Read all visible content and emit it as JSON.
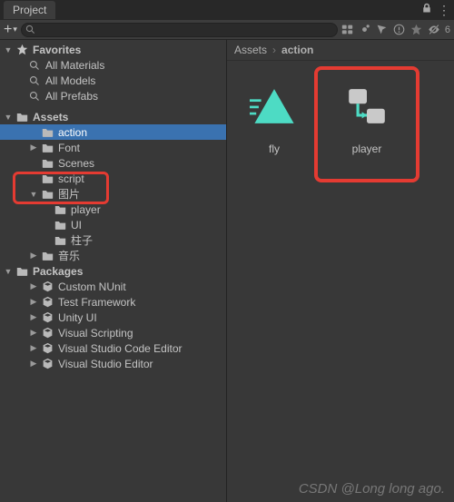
{
  "tab": {
    "title": "Project"
  },
  "toolbar": {
    "search_placeholder": "",
    "hidden_count": "6"
  },
  "breadcrumb": {
    "root": "Assets",
    "current": "action"
  },
  "tree": {
    "favorites_label": "Favorites",
    "favorites": [
      {
        "label": "All Materials"
      },
      {
        "label": "All Models"
      },
      {
        "label": "All Prefabs"
      }
    ],
    "assets_label": "Assets",
    "assets_children": [
      {
        "label": "action",
        "icon": "folder",
        "selected": true,
        "fold": "none",
        "indent": 2
      },
      {
        "label": "Font",
        "icon": "folder",
        "fold": "closed",
        "indent": 2
      },
      {
        "label": "Scenes",
        "icon": "folder",
        "fold": "none",
        "indent": 2
      },
      {
        "label": "script",
        "icon": "folder",
        "fold": "none",
        "indent": 2
      },
      {
        "label": "图片",
        "icon": "folder",
        "fold": "open",
        "indent": 2
      },
      {
        "label": "player",
        "icon": "folder",
        "fold": "none",
        "indent": 3
      },
      {
        "label": "UI",
        "icon": "folder",
        "fold": "none",
        "indent": 3
      },
      {
        "label": "柱子",
        "icon": "folder",
        "fold": "none",
        "indent": 3
      },
      {
        "label": "音乐",
        "icon": "folder",
        "fold": "closed",
        "indent": 2
      }
    ],
    "packages_label": "Packages",
    "packages_children": [
      {
        "label": "Custom NUnit",
        "icon": "package",
        "fold": "closed",
        "indent": 2
      },
      {
        "label": "Test Framework",
        "icon": "package",
        "fold": "closed",
        "indent": 2
      },
      {
        "label": "Unity UI",
        "icon": "package",
        "fold": "closed",
        "indent": 2
      },
      {
        "label": "Visual Scripting",
        "icon": "package",
        "fold": "closed",
        "indent": 2
      },
      {
        "label": "Visual Studio Code Editor",
        "icon": "package",
        "fold": "closed",
        "indent": 2
      },
      {
        "label": "Visual Studio Editor",
        "icon": "package",
        "fold": "closed",
        "indent": 2
      }
    ]
  },
  "grid": {
    "items": [
      {
        "label": "fly",
        "kind": "anim-triangle"
      },
      {
        "label": "player",
        "kind": "anim-controller"
      }
    ]
  },
  "footer": {
    "watermark": "CSDN @Long long ago."
  }
}
